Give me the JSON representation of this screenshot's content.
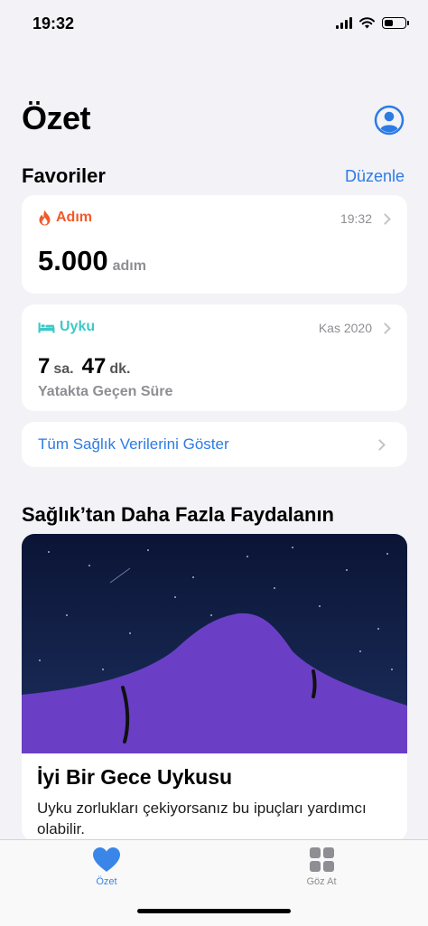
{
  "status": {
    "time": "19:32"
  },
  "header": {
    "title": "Özet",
    "profile_icon": "person-circle-icon"
  },
  "favorites": {
    "title": "Favoriler",
    "edit_label": "Düzenle",
    "steps": {
      "label": "Adım",
      "time": "19:32",
      "value": "5.000",
      "unit": "adım",
      "color": "#f05a28",
      "icon": "flame-icon"
    },
    "sleep": {
      "label": "Uyku",
      "date": "Kas 2020",
      "hours": "7",
      "hours_unit": "sa.",
      "minutes": "47",
      "minutes_unit": "dk.",
      "subtitle": "Yatakta Geçen Süre",
      "color": "#3fc8c8",
      "icon": "bed-icon"
    },
    "show_all_label": "Tüm Sağlık Verilerini Göster"
  },
  "more": {
    "title": "Sağlık’tan Daha Fazla Faydalanın",
    "card": {
      "title": "İyi Bir Gece Uykusu",
      "text": "Uyku zorlukları çekiyorsanız bu ipuçları yardımcı olabilir."
    }
  },
  "tabs": [
    {
      "label": "Özet",
      "icon": "heart-icon",
      "active": true
    },
    {
      "label": "Göz At",
      "icon": "grid-icon",
      "active": false
    }
  ],
  "colors": {
    "accent": "#2c7be5",
    "tab_active": "#3a86e8",
    "tab_inactive": "#8e8e93"
  }
}
